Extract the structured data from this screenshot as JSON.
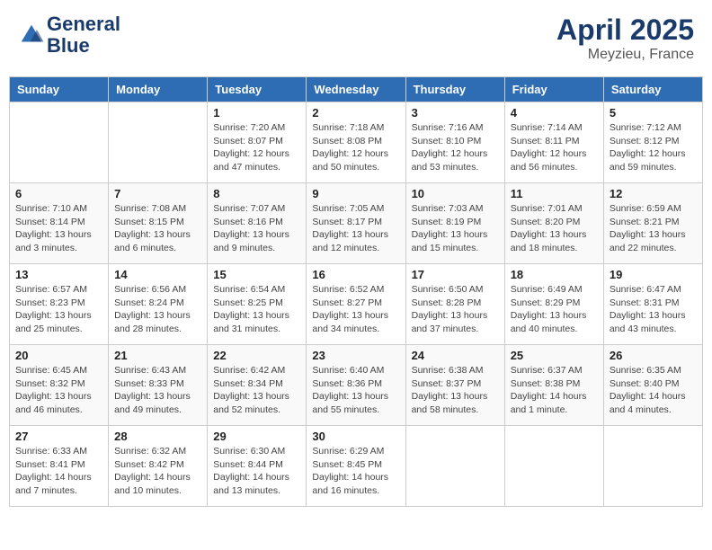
{
  "header": {
    "logo_line1": "General",
    "logo_line2": "Blue",
    "month_year": "April 2025",
    "location": "Meyzieu, France"
  },
  "weekdays": [
    "Sunday",
    "Monday",
    "Tuesday",
    "Wednesday",
    "Thursday",
    "Friday",
    "Saturday"
  ],
  "rows": [
    [
      {
        "day": "",
        "info": ""
      },
      {
        "day": "",
        "info": ""
      },
      {
        "day": "1",
        "info": "Sunrise: 7:20 AM\nSunset: 8:07 PM\nDaylight: 12 hours and 47 minutes."
      },
      {
        "day": "2",
        "info": "Sunrise: 7:18 AM\nSunset: 8:08 PM\nDaylight: 12 hours and 50 minutes."
      },
      {
        "day": "3",
        "info": "Sunrise: 7:16 AM\nSunset: 8:10 PM\nDaylight: 12 hours and 53 minutes."
      },
      {
        "day": "4",
        "info": "Sunrise: 7:14 AM\nSunset: 8:11 PM\nDaylight: 12 hours and 56 minutes."
      },
      {
        "day": "5",
        "info": "Sunrise: 7:12 AM\nSunset: 8:12 PM\nDaylight: 12 hours and 59 minutes."
      }
    ],
    [
      {
        "day": "6",
        "info": "Sunrise: 7:10 AM\nSunset: 8:14 PM\nDaylight: 13 hours and 3 minutes."
      },
      {
        "day": "7",
        "info": "Sunrise: 7:08 AM\nSunset: 8:15 PM\nDaylight: 13 hours and 6 minutes."
      },
      {
        "day": "8",
        "info": "Sunrise: 7:07 AM\nSunset: 8:16 PM\nDaylight: 13 hours and 9 minutes."
      },
      {
        "day": "9",
        "info": "Sunrise: 7:05 AM\nSunset: 8:17 PM\nDaylight: 13 hours and 12 minutes."
      },
      {
        "day": "10",
        "info": "Sunrise: 7:03 AM\nSunset: 8:19 PM\nDaylight: 13 hours and 15 minutes."
      },
      {
        "day": "11",
        "info": "Sunrise: 7:01 AM\nSunset: 8:20 PM\nDaylight: 13 hours and 18 minutes."
      },
      {
        "day": "12",
        "info": "Sunrise: 6:59 AM\nSunset: 8:21 PM\nDaylight: 13 hours and 22 minutes."
      }
    ],
    [
      {
        "day": "13",
        "info": "Sunrise: 6:57 AM\nSunset: 8:23 PM\nDaylight: 13 hours and 25 minutes."
      },
      {
        "day": "14",
        "info": "Sunrise: 6:56 AM\nSunset: 8:24 PM\nDaylight: 13 hours and 28 minutes."
      },
      {
        "day": "15",
        "info": "Sunrise: 6:54 AM\nSunset: 8:25 PM\nDaylight: 13 hours and 31 minutes."
      },
      {
        "day": "16",
        "info": "Sunrise: 6:52 AM\nSunset: 8:27 PM\nDaylight: 13 hours and 34 minutes."
      },
      {
        "day": "17",
        "info": "Sunrise: 6:50 AM\nSunset: 8:28 PM\nDaylight: 13 hours and 37 minutes."
      },
      {
        "day": "18",
        "info": "Sunrise: 6:49 AM\nSunset: 8:29 PM\nDaylight: 13 hours and 40 minutes."
      },
      {
        "day": "19",
        "info": "Sunrise: 6:47 AM\nSunset: 8:31 PM\nDaylight: 13 hours and 43 minutes."
      }
    ],
    [
      {
        "day": "20",
        "info": "Sunrise: 6:45 AM\nSunset: 8:32 PM\nDaylight: 13 hours and 46 minutes."
      },
      {
        "day": "21",
        "info": "Sunrise: 6:43 AM\nSunset: 8:33 PM\nDaylight: 13 hours and 49 minutes."
      },
      {
        "day": "22",
        "info": "Sunrise: 6:42 AM\nSunset: 8:34 PM\nDaylight: 13 hours and 52 minutes."
      },
      {
        "day": "23",
        "info": "Sunrise: 6:40 AM\nSunset: 8:36 PM\nDaylight: 13 hours and 55 minutes."
      },
      {
        "day": "24",
        "info": "Sunrise: 6:38 AM\nSunset: 8:37 PM\nDaylight: 13 hours and 58 minutes."
      },
      {
        "day": "25",
        "info": "Sunrise: 6:37 AM\nSunset: 8:38 PM\nDaylight: 14 hours and 1 minute."
      },
      {
        "day": "26",
        "info": "Sunrise: 6:35 AM\nSunset: 8:40 PM\nDaylight: 14 hours and 4 minutes."
      }
    ],
    [
      {
        "day": "27",
        "info": "Sunrise: 6:33 AM\nSunset: 8:41 PM\nDaylight: 14 hours and 7 minutes."
      },
      {
        "day": "28",
        "info": "Sunrise: 6:32 AM\nSunset: 8:42 PM\nDaylight: 14 hours and 10 minutes."
      },
      {
        "day": "29",
        "info": "Sunrise: 6:30 AM\nSunset: 8:44 PM\nDaylight: 14 hours and 13 minutes."
      },
      {
        "day": "30",
        "info": "Sunrise: 6:29 AM\nSunset: 8:45 PM\nDaylight: 14 hours and 16 minutes."
      },
      {
        "day": "",
        "info": ""
      },
      {
        "day": "",
        "info": ""
      },
      {
        "day": "",
        "info": ""
      }
    ]
  ]
}
